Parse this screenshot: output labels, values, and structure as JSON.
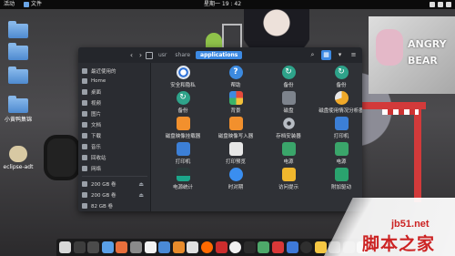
{
  "topbar": {
    "activities": "活动",
    "app_menu": "文件",
    "clock": "星期一 19 : 42"
  },
  "desktop": {
    "icons": [
      {
        "label": ""
      },
      {
        "label": ""
      },
      {
        "label": ""
      },
      {
        "label": "小黄鸭集锦"
      },
      {
        "label": "eclipse-adt"
      }
    ],
    "wallpaper_sign": "ANGRY BEAR"
  },
  "file_manager": {
    "path": [
      "usr",
      "share",
      "applications"
    ],
    "sidebar": {
      "places": [
        "最近使用的",
        "Home",
        "桌面",
        "视频",
        "图片",
        "文档",
        "下载",
        "音乐",
        "回收站",
        "网络"
      ],
      "volumes": [
        "200 GB 卷",
        "200 GB 卷",
        "82 GB 卷"
      ]
    },
    "apps": [
      {
        "label": "安全和隐私",
        "icon": "privacy-eye-icon",
        "class": "ic-eye"
      },
      {
        "label": "帮助",
        "icon": "help-icon",
        "class": "ic-help"
      },
      {
        "label": "备份",
        "icon": "backup-icon",
        "class": "ic-backup"
      },
      {
        "label": "备份",
        "icon": "backup-icon",
        "class": "ic-backup"
      },
      {
        "label": "备份",
        "icon": "backup-icon",
        "class": "ic-backup"
      },
      {
        "label": "背景",
        "icon": "wallpaper-icon",
        "class": "ic-wall"
      },
      {
        "label": "磁盘",
        "icon": "disk-icon",
        "class": "ic-disk"
      },
      {
        "label": "磁盘使用情况分析器",
        "icon": "disk-usage-icon",
        "class": "ic-pie"
      },
      {
        "label": "磁盘映像挂载器",
        "icon": "disk-image-mounter-icon",
        "class": "ic-orange"
      },
      {
        "label": "磁盘映像写入器",
        "icon": "disk-image-writer-icon",
        "class": "ic-orange"
      },
      {
        "label": "存档安装器",
        "icon": "archive-installer-icon",
        "class": "ic-gear"
      },
      {
        "label": "打印机",
        "icon": "printer-icon",
        "class": "ic-print"
      },
      {
        "label": "打印机",
        "icon": "printer-icon",
        "class": "ic-print"
      },
      {
        "label": "打印预览",
        "icon": "print-preview-icon",
        "class": "ic-print2"
      },
      {
        "label": "电源",
        "icon": "power-icon",
        "class": "ic-battery"
      },
      {
        "label": "电源",
        "icon": "power-icon",
        "class": "ic-battery"
      },
      {
        "label": "电源统计",
        "icon": "power-statistics-icon",
        "class": "ic-chart"
      },
      {
        "label": "时对期",
        "icon": "clock-icon",
        "class": "ic-clock"
      },
      {
        "label": "访问提示",
        "icon": "access-prompt-icon",
        "class": "ic-lock"
      },
      {
        "label": "附加驱动",
        "icon": "additional-drivers-icon",
        "class": "ic-drive"
      }
    ]
  },
  "dock": {
    "items": [
      "dock-app",
      "dock-app",
      "dock-app",
      "dock-app",
      "dock-app",
      "dock-app",
      "dock-app",
      "dock-app",
      "dock-app",
      "dock-app",
      "dock-app",
      "dock-app",
      "dock-app",
      "dock-app",
      "dock-app",
      "dock-app",
      "dock-app",
      "dock-app",
      "dock-app",
      "dock-app",
      "dock-app",
      "dock-app"
    ],
    "colors": [
      "#d8d8d8",
      "#3d3d3d",
      "#4b4b4b",
      "#5aa0e8",
      "#e96f3c",
      "#8a8a8a",
      "#f2f2f2",
      "#4a8ad6",
      "#e88b2b",
      "#e0e0e0",
      "#ff6a00",
      "#cc2d2d",
      "#f0f0f0",
      "#2b2b2b",
      "#4ea86a",
      "#d93838",
      "#3e79d8",
      "#2f2f2f",
      "#f5c743",
      "#777777",
      "#5c5c5c",
      "#bdbdbd"
    ]
  },
  "watermark": {
    "site": "jb51.net",
    "name": "脚本之家"
  }
}
